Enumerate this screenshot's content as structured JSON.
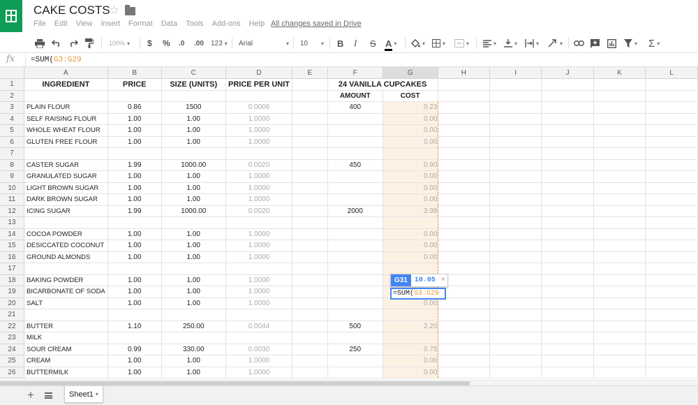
{
  "app": {
    "title": "CAKE COSTS",
    "menus": [
      "File",
      "Edit",
      "View",
      "Insert",
      "Format",
      "Data",
      "Tools",
      "Add-ons",
      "Help"
    ],
    "save_status": "All changes saved in Drive"
  },
  "toolbar": {
    "zoom": "100%",
    "currency": "$",
    "percent": "%",
    "decrease_decimals": ".0",
    "increase_decimals": ".00",
    "more_formats": "123",
    "font": "Arial",
    "font_size": "10",
    "bold": "B",
    "italic": "I",
    "strike": "S",
    "text_color": "A"
  },
  "formula_bar": {
    "fx_label": "fx",
    "prefix": "=SUM(",
    "range": "G3:G29"
  },
  "columns": [
    "A",
    "B",
    "C",
    "D",
    "E",
    "F",
    "G",
    "H",
    "I",
    "J",
    "K",
    "L"
  ],
  "header_row": {
    "ingredient": "INGREDIENT",
    "price": "PRICE",
    "size": "SIZE (UNITS)",
    "ppu": "PRICE PER UNIT",
    "recipe": "24 VANILLA CUPCAKES",
    "amount": "AMOUNT",
    "cost": "COST"
  },
  "rows": [
    {
      "n": "3",
      "a": "PLAIN FLOUR",
      "b": "0.86",
      "c": "1500",
      "d": "0.0006",
      "f": "400",
      "g": "0.23"
    },
    {
      "n": "4",
      "a": "SELF RAISING FLOUR",
      "b": "1.00",
      "c": "1.00",
      "d": "1.0000",
      "f": "",
      "g": "0.00"
    },
    {
      "n": "5",
      "a": "WHOLE WHEAT FLOUR",
      "b": "1.00",
      "c": "1.00",
      "d": "1.0000",
      "f": "",
      "g": "0.00"
    },
    {
      "n": "6",
      "a": "GLUTEN FREE FLOUR",
      "b": "1.00",
      "c": "1.00",
      "d": "1.0000",
      "f": "",
      "g": "0.00"
    },
    {
      "n": "7",
      "a": "",
      "b": "",
      "c": "",
      "d": "",
      "f": "",
      "g": ""
    },
    {
      "n": "8",
      "a": "CASTER SUGAR",
      "b": "1.99",
      "c": "1000.00",
      "d": "0.0020",
      "f": "450",
      "g": "0.90"
    },
    {
      "n": "9",
      "a": "GRANULATED SUGAR",
      "b": "1.00",
      "c": "1.00",
      "d": "1.0000",
      "f": "",
      "g": "0.00"
    },
    {
      "n": "10",
      "a": "LIGHT BROWN SUGAR",
      "b": "1.00",
      "c": "1.00",
      "d": "1.0000",
      "f": "",
      "g": "0.00"
    },
    {
      "n": "11",
      "a": "DARK BROWN SUGAR",
      "b": "1.00",
      "c": "1.00",
      "d": "1.0000",
      "f": "",
      "g": "0.00"
    },
    {
      "n": "12",
      "a": "ICING SUGAR",
      "b": "1.99",
      "c": "1000.00",
      "d": "0.0020",
      "f": "2000",
      "g": "3.98"
    },
    {
      "n": "13",
      "a": "",
      "b": "",
      "c": "",
      "d": "",
      "f": "",
      "g": ""
    },
    {
      "n": "14",
      "a": "COCOA POWDER",
      "b": "1.00",
      "c": "1.00",
      "d": "1.0000",
      "f": "",
      "g": "0.00"
    },
    {
      "n": "15",
      "a": "DESICCATED COCONUT",
      "b": "1.00",
      "c": "1.00",
      "d": "1.0000",
      "f": "",
      "g": "0.00"
    },
    {
      "n": "16",
      "a": "GROUND ALMONDS",
      "b": "1.00",
      "c": "1.00",
      "d": "1.0000",
      "f": "",
      "g": "0.00"
    },
    {
      "n": "17",
      "a": "",
      "b": "",
      "c": "",
      "d": "",
      "f": "",
      "g": ""
    },
    {
      "n": "18",
      "a": "BAKING POWDER",
      "b": "1.00",
      "c": "1.00",
      "d": "1.0000",
      "f": "",
      "g": ""
    },
    {
      "n": "19",
      "a": "BICARBONATE OF SODA",
      "b": "1.00",
      "c": "1.00",
      "d": "1.0000",
      "f": "",
      "g": ""
    },
    {
      "n": "20",
      "a": "SALT",
      "b": "1.00",
      "c": "1.00",
      "d": "1.0000",
      "f": "",
      "g": "0.00"
    },
    {
      "n": "21",
      "a": "",
      "b": "",
      "c": "",
      "d": "",
      "f": "",
      "g": ""
    },
    {
      "n": "22",
      "a": "BUTTER",
      "b": "1.10",
      "c": "250.00",
      "d": "0.0044",
      "f": "500",
      "g": "2.20"
    },
    {
      "n": "23",
      "a": "MILK",
      "b": "",
      "c": "",
      "d": "",
      "f": "",
      "g": ""
    },
    {
      "n": "24",
      "a": "SOUR CREAM",
      "b": "0.99",
      "c": "330.00",
      "d": "0.0030",
      "f": "250",
      "g": "0.75"
    },
    {
      "n": "25",
      "a": "CREAM",
      "b": "1.00",
      "c": "1.00",
      "d": "1.0000",
      "f": "",
      "g": "0.00"
    },
    {
      "n": "26",
      "a": "BUTTERMILK",
      "b": "1.00",
      "c": "1.00",
      "d": "1.0000",
      "f": "",
      "g": "0.00"
    }
  ],
  "chip": {
    "ref": "G31",
    "value": "10.05",
    "close": "×"
  },
  "editor": {
    "prefix": "=SUM(",
    "range": "G3:G29"
  },
  "sheet_tab": "Sheet1"
}
